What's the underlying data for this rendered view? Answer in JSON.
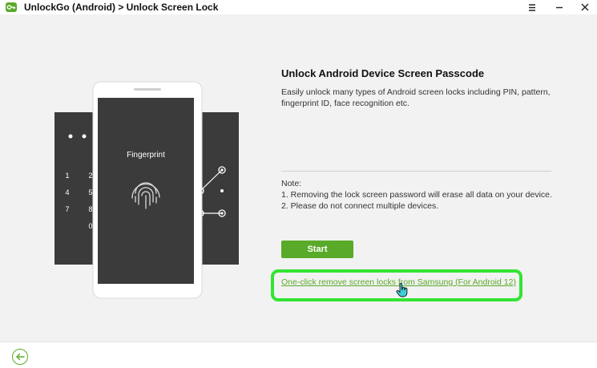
{
  "window": {
    "title": "UnlockGo (Android) > Unlock Screen Lock",
    "controls": [
      "menu-icon",
      "minimize-icon",
      "close-icon"
    ]
  },
  "illustration": {
    "phone_screen_label": "Fingerprint",
    "keypad_digits": [
      "1",
      "2",
      "4",
      "5",
      "7",
      "8",
      "0"
    ]
  },
  "main": {
    "heading": "Unlock Android Device Screen Passcode",
    "description": "Easily unlock many types of Android screen locks including PIN, pattern, fingerprint ID, face recognition etc.",
    "note_title": "Note:",
    "notes": [
      "1. Removing the lock screen password will erase all data on your device.",
      "2. Please do not connect multiple devices."
    ],
    "start_label": "Start",
    "samsung_link": "One-click remove screen locks from Samsung (For Android 12)"
  },
  "footer": {
    "back_icon": "back-arrow-icon"
  },
  "colors": {
    "brand_green": "#5aaa2a",
    "highlight_green": "#33e433",
    "panel_dark": "#3b3b3b",
    "background": "#f2f2f2"
  }
}
